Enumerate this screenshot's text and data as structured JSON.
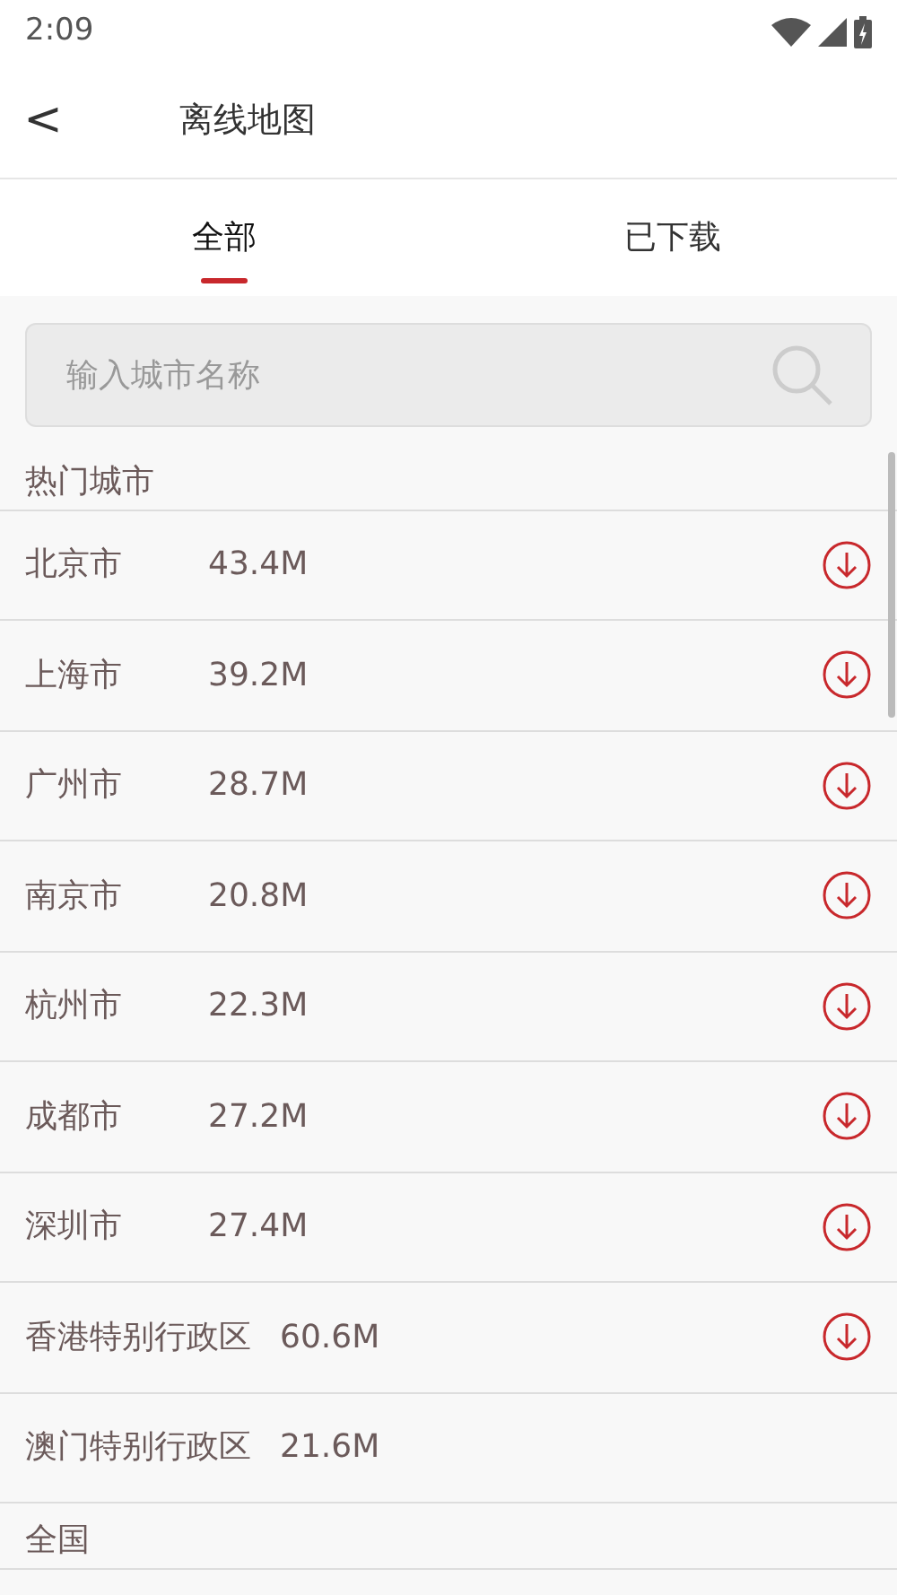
{
  "status_bar": {
    "time": "2:09"
  },
  "header": {
    "back": "<",
    "title": "离线地图"
  },
  "tabs": [
    {
      "label": "全部",
      "selected": true
    },
    {
      "label": "已下载",
      "selected": false
    }
  ],
  "search": {
    "placeholder": "输入城市名称"
  },
  "sections": [
    {
      "title": "热门城市",
      "cities": [
        {
          "name": "北京市",
          "size": "43.4M",
          "download_icon": true
        },
        {
          "name": "上海市",
          "size": "39.2M",
          "download_icon": true
        },
        {
          "name": "广州市",
          "size": "28.7M",
          "download_icon": true
        },
        {
          "name": "南京市",
          "size": "20.8M",
          "download_icon": true
        },
        {
          "name": "杭州市",
          "size": "22.3M",
          "download_icon": true
        },
        {
          "name": "成都市",
          "size": "27.2M",
          "download_icon": true
        },
        {
          "name": "深圳市",
          "size": "27.4M",
          "download_icon": true
        },
        {
          "name": "香港特别行政区",
          "size": "60.6M",
          "download_icon": true
        },
        {
          "name": "澳门特别行政区",
          "size": "21.6M",
          "download_icon": false
        }
      ]
    },
    {
      "title": "全国"
    }
  ]
}
